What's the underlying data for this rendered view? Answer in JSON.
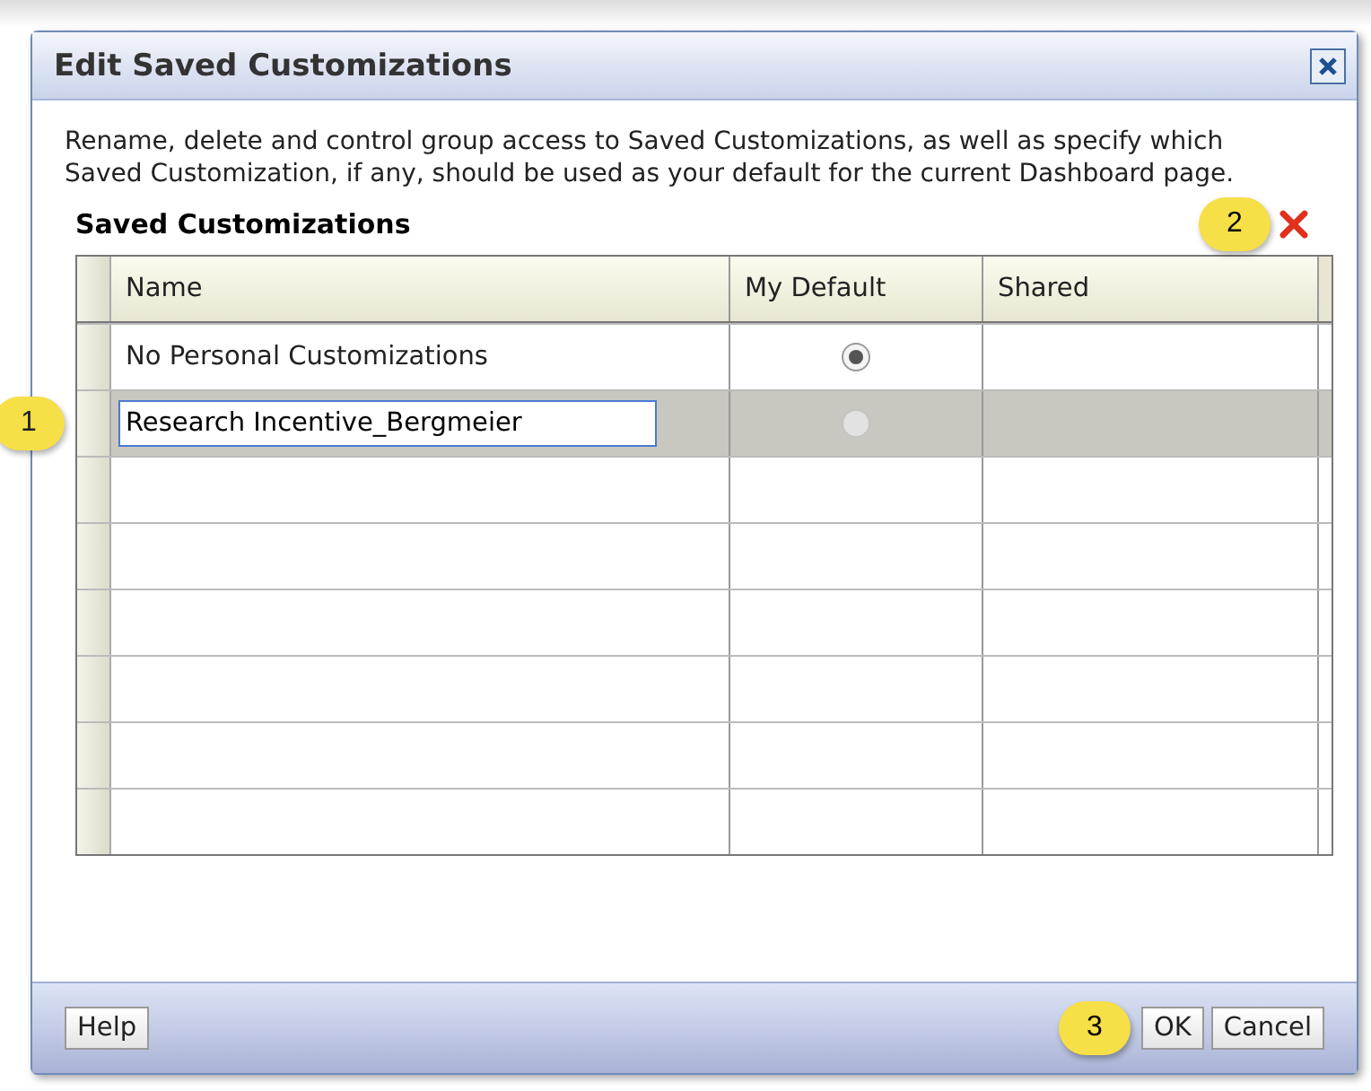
{
  "window": {
    "title": "Edit Saved Customizations"
  },
  "description": "Rename, delete and control group access to Saved Customizations, as well as specify which Saved Customization, if any, should be used as your default for the current Dashboard page.",
  "section_title": "Saved Customizations",
  "table": {
    "columns": [
      "Name",
      "My Default",
      "Shared"
    ],
    "rows": [
      {
        "name": "No Personal Customizations",
        "editing": false,
        "selected": false,
        "my_default": true
      },
      {
        "name": "Research Incentive_Bergmeier",
        "editing": true,
        "selected": true,
        "my_default": false
      }
    ]
  },
  "callouts": [
    "1",
    "2",
    "3"
  ],
  "buttons": {
    "help": "Help",
    "ok": "OK",
    "cancel": "Cancel"
  }
}
